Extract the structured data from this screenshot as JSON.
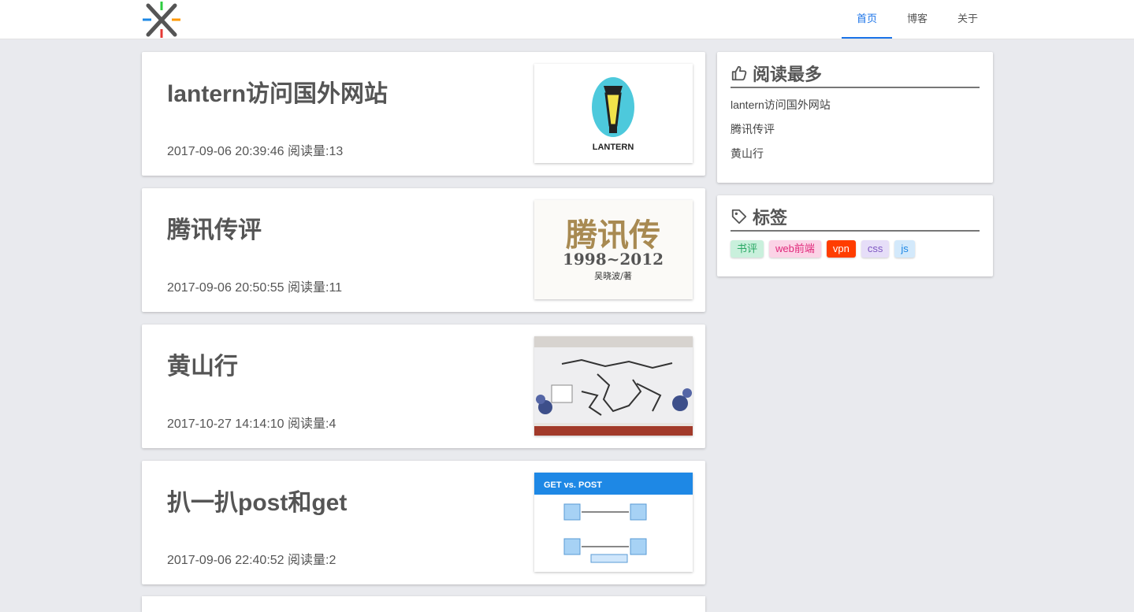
{
  "nav": {
    "items": [
      {
        "label": "首页",
        "active": true
      },
      {
        "label": "博客",
        "active": false
      },
      {
        "label": "关于",
        "active": false
      }
    ]
  },
  "posts": [
    {
      "title": "lantern访问国外网站",
      "meta": "2017-09-06 20:39:46 阅读量:13",
      "thumb_text": "LANTERN"
    },
    {
      "title": "腾讯传评",
      "meta": "2017-09-06 20:50:55 阅读量:11",
      "thumb_text": "腾讯传",
      "thumb_sub": "1998~2012",
      "thumb_author": "吴晓波/著"
    },
    {
      "title": "黄山行",
      "meta": "2017-10-27 14:14:10 阅读量:4"
    },
    {
      "title": "扒一扒post和get",
      "meta": "2017-09-06 22:40:52 阅读量:2",
      "thumb_text": "GET vs. POST"
    }
  ],
  "sidebar": {
    "most_read": {
      "title": "阅读最多",
      "icon": "thumbs-up-icon",
      "items": [
        "lantern访问国外网站",
        "腾讯传评",
        "黄山行"
      ]
    },
    "tags": {
      "title": "标签",
      "icon": "tag-icon",
      "items": [
        {
          "label": "书评",
          "bg": "#c9f0dc",
          "color": "#2aa864"
        },
        {
          "label": "web前端",
          "bg": "#fbd3e6",
          "color": "#e0287a"
        },
        {
          "label": "vpn",
          "bg": "#ff3d00",
          "color": "#ffffff"
        },
        {
          "label": "css",
          "bg": "#e6def8",
          "color": "#7e57c2"
        },
        {
          "label": "js",
          "bg": "#d3e9fb",
          "color": "#1e88e5"
        }
      ]
    }
  },
  "colors": {
    "accent": "#1a73e8",
    "background": "#e9eaee"
  }
}
